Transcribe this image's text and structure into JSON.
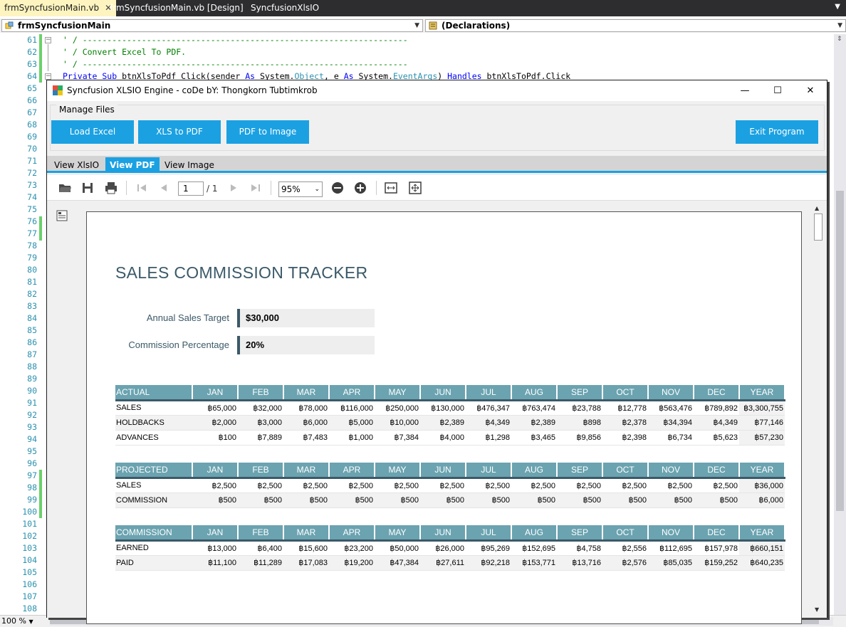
{
  "ide": {
    "tabs": [
      {
        "label": "frmSyncfusionMain.vb",
        "active": true
      },
      {
        "label": "frmSyncfusionMain.vb [Design]",
        "active": false
      },
      {
        "label": "SyncfusionXlsIO",
        "active": false
      }
    ],
    "class_combo": "frmSyncfusionMain",
    "member_combo": "(Declarations)",
    "zoom": "100 %",
    "line_numbers": [
      "61",
      "62",
      "63",
      "64",
      "65",
      "66",
      "67",
      "68",
      "69",
      "70",
      "71",
      "72",
      "73",
      "74",
      "75",
      "76",
      "77",
      "78",
      "79",
      "80",
      "81",
      "82",
      "83",
      "84",
      "85",
      "86",
      "87",
      "88",
      "89",
      "90",
      "91",
      "92",
      "93",
      "94",
      "95",
      "96",
      "97",
      "98",
      "99",
      "100",
      "101",
      "102",
      "103",
      "104",
      "105",
      "106",
      "107",
      "108"
    ],
    "code_lines": [
      "' / ------------------------------------------------------------------",
      "' / Convert Excel To PDF.",
      "' / ------------------------------------------------------------------"
    ],
    "code_line_64": {
      "kw1": "Private Sub",
      "t1": " btnXlsToPdf_Click(sender ",
      "kw2": "As",
      "t2": " System.",
      "ty1": "Object",
      "t3": ", e ",
      "kw3": "As",
      "t4": " System.",
      "ty2": "EventArgs",
      "t5": ") ",
      "kw4": "Handles",
      "t6": " btnXlsToPdf.Click"
    }
  },
  "window": {
    "title": "Syncfusion XLSIO Engine - coDe bY: Thongkorn Tubtimkrob",
    "minimize": "—",
    "maximize": "☐",
    "close": "✕"
  },
  "manage": {
    "group_label": "Manage Files",
    "load_excel": "Load Excel",
    "xls_to_pdf": "XLS to PDF",
    "pdf_to_image": "PDF to Image",
    "exit": "Exit Program"
  },
  "tabs": [
    "View XlsIO",
    "View PDF",
    "View Image"
  ],
  "pdf_toolbar": {
    "page": "1",
    "total": "/ 1",
    "zoom": "95%"
  },
  "doc": {
    "title": "SALES COMMISSION TRACKER",
    "target_label": "Annual Sales Target",
    "target_value": "$30,000",
    "pct_label": "Commission Percentage",
    "pct_value": "20%",
    "months": [
      "JAN",
      "FEB",
      "MAR",
      "APR",
      "MAY",
      "JUN",
      "JUL",
      "AUG",
      "SEP",
      "OCT",
      "NOV",
      "DEC",
      "YEAR"
    ],
    "tables": [
      {
        "header": "ACTUAL",
        "rows": [
          {
            "label": "SALES",
            "values": [
              "฿65,000",
              "฿32,000",
              "฿78,000",
              "฿116,000",
              "฿250,000",
              "฿130,000",
              "฿476,347",
              "฿763,474",
              "฿23,788",
              "฿12,778",
              "฿563,476",
              "฿789,892",
              "฿3,300,755"
            ]
          },
          {
            "label": "HOLDBACKS",
            "values": [
              "฿2,000",
              "฿3,000",
              "฿6,000",
              "฿5,000",
              "฿10,000",
              "฿2,389",
              "฿4,349",
              "฿2,389",
              "฿898",
              "฿2,378",
              "฿34,394",
              "฿4,349",
              "฿77,146"
            ]
          },
          {
            "label": "ADVANCES",
            "values": [
              "฿100",
              "฿7,889",
              "฿7,483",
              "฿1,000",
              "฿7,384",
              "฿4,000",
              "฿1,298",
              "฿3,465",
              "฿9,856",
              "฿2,398",
              "฿6,734",
              "฿5,623",
              "฿57,230"
            ]
          }
        ]
      },
      {
        "header": "PROJECTED",
        "rows": [
          {
            "label": "SALES",
            "values": [
              "฿2,500",
              "฿2,500",
              "฿2,500",
              "฿2,500",
              "฿2,500",
              "฿2,500",
              "฿2,500",
              "฿2,500",
              "฿2,500",
              "฿2,500",
              "฿2,500",
              "฿2,500",
              "฿36,000"
            ]
          },
          {
            "label": "COMMISSION",
            "values": [
              "฿500",
              "฿500",
              "฿500",
              "฿500",
              "฿500",
              "฿500",
              "฿500",
              "฿500",
              "฿500",
              "฿500",
              "฿500",
              "฿500",
              "฿6,000"
            ]
          }
        ]
      },
      {
        "header": "COMMISSION",
        "rows": [
          {
            "label": "EARNED",
            "values": [
              "฿13,000",
              "฿6,400",
              "฿15,600",
              "฿23,200",
              "฿50,000",
              "฿26,000",
              "฿95,269",
              "฿152,695",
              "฿4,758",
              "฿2,556",
              "฿112,695",
              "฿157,978",
              "฿660,151"
            ]
          },
          {
            "label": "PAID",
            "values": [
              "฿11,100",
              "฿11,289",
              "฿17,083",
              "฿19,200",
              "฿47,384",
              "฿27,611",
              "฿92,218",
              "฿153,771",
              "฿13,716",
              "฿2,576",
              "฿85,035",
              "฿159,252",
              "฿640,235"
            ]
          }
        ]
      }
    ]
  },
  "colors": {
    "accent": "#1ba1e2",
    "header_teal": "#6ba3b0",
    "title_slate": "#3b5968"
  }
}
